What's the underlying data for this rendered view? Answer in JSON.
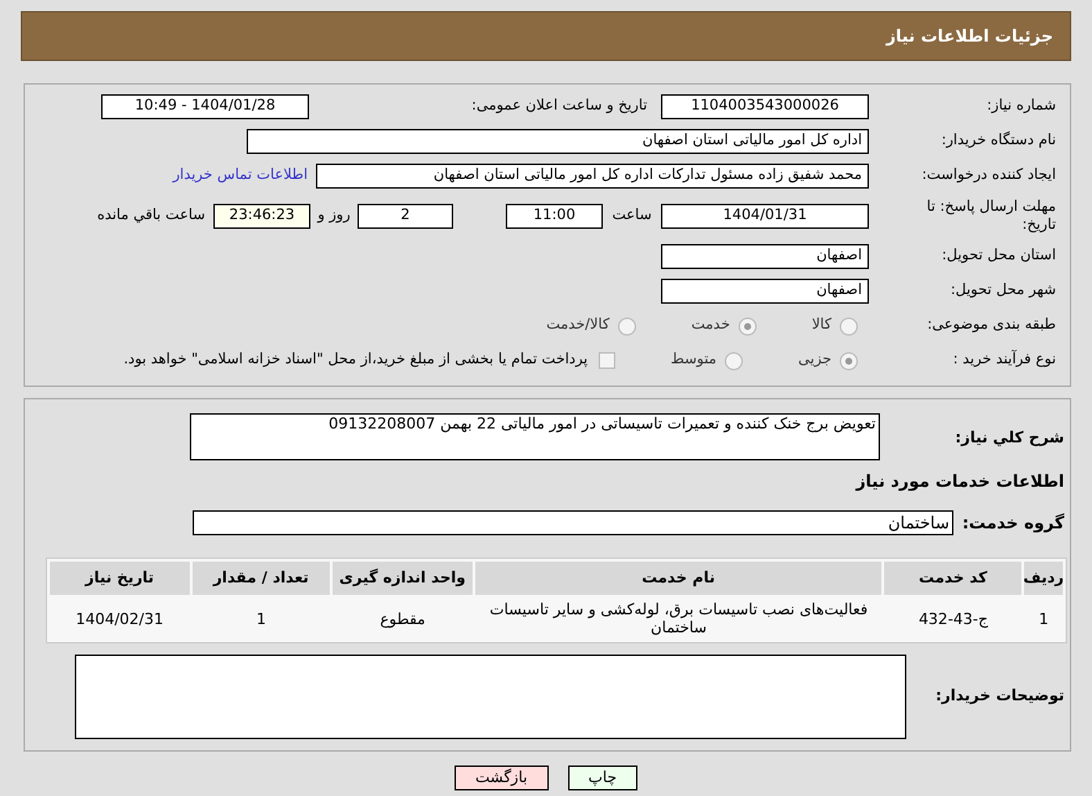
{
  "header": {
    "title": "جزئیات اطلاعات نیاز"
  },
  "details": {
    "need_number": {
      "label": "شماره نیاز:",
      "value": "1104003543000026"
    },
    "announce": {
      "label": "تاریخ و ساعت اعلان عمومی:",
      "value": "1404/01/28 - 10:49"
    },
    "buyer_org": {
      "label": "نام دستگاه خریدار:",
      "value": "اداره کل امور مالیاتی استان اصفهان"
    },
    "requester": {
      "label": "ایجاد کننده درخواست:",
      "value": "محمد شفیق زاده مسئول تدارکات اداره کل امور مالیاتی استان اصفهان",
      "link": "اطلاعات تماس خریدار"
    },
    "deadline": {
      "label": "مهلت ارسال پاسخ: تا تاریخ:",
      "date": "1404/01/31",
      "time_label": "ساعت",
      "time": "11:00",
      "days": "2",
      "days_label": "روز و",
      "remaining": "23:46:23",
      "remaining_label": "ساعت باقي مانده"
    },
    "province": {
      "label": "استان محل تحویل:",
      "value": "اصفهان"
    },
    "city": {
      "label": "شهر محل تحویل:",
      "value": "اصفهان"
    },
    "category": {
      "label": "طبقه بندی موضوعی:",
      "options": [
        {
          "label": "کالا",
          "selected": false
        },
        {
          "label": "خدمت",
          "selected": true
        },
        {
          "label": "کالا/خدمت",
          "selected": false
        }
      ]
    },
    "process": {
      "label": "نوع فرآیند خرید :",
      "options": [
        {
          "label": "جزیی",
          "selected": true
        },
        {
          "label": "متوسط",
          "selected": false
        }
      ],
      "payment": {
        "label": "پرداخت تمام یا بخشی از مبلغ خرید،از محل \"اسناد خزانه اسلامی\" خواهد بود.",
        "checked": false
      }
    }
  },
  "services": {
    "description": {
      "label": "شرح کلي نياز:",
      "value": "تعویض برج خنک کننده و تعمیرات تاسیساتی در امور مالیاتی 22 بهمن 09132208007"
    },
    "heading": "اطلاعات خدمات مورد نیاز",
    "group": {
      "label": "گروه خدمت:",
      "value": "ساختمان"
    },
    "table": {
      "columns": [
        "ردیف",
        "کد خدمت",
        "نام خدمت",
        "واحد اندازه گیری",
        "تعداد / مقدار",
        "تاریخ نیاز"
      ],
      "rows": [
        [
          "1",
          "ج-43-432",
          "فعالیت‌های نصب تاسیسات برق، لوله‌کشی و سایر تاسیسات ساختمان",
          "مقطوع",
          "1",
          "1404/02/31"
        ]
      ]
    },
    "buyer_notes": {
      "label": "توضیحات خریدار:"
    }
  },
  "buttons": [
    {
      "label": "چاپ",
      "kind": "print"
    },
    {
      "label": "بازگشت",
      "kind": "back"
    }
  ]
}
